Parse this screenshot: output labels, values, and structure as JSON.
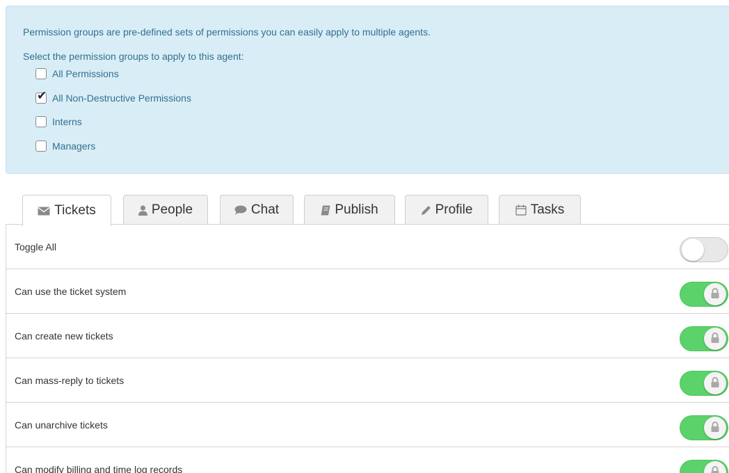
{
  "info": {
    "line1": "Permission groups are pre-defined sets of permissions you can easily apply to multiple agents.",
    "line2": "Select the permission groups to apply to this agent:",
    "groups": [
      {
        "label": "All Permissions",
        "checked": false
      },
      {
        "label": "All Non-Destructive Permissions",
        "checked": true
      },
      {
        "label": "Interns",
        "checked": false
      },
      {
        "label": "Managers",
        "checked": false
      }
    ]
  },
  "tabs": [
    {
      "label": "Tickets",
      "icon": "envelope-icon",
      "active": true
    },
    {
      "label": "People",
      "icon": "person-icon",
      "active": false
    },
    {
      "label": "Chat",
      "icon": "speech-bubble-icon",
      "active": false
    },
    {
      "label": "Publish",
      "icon": "book-icon",
      "active": false
    },
    {
      "label": "Profile",
      "icon": "pencil-icon",
      "active": false
    },
    {
      "label": "Tasks",
      "icon": "calendar-icon",
      "active": false
    }
  ],
  "permissions": [
    {
      "label": "Toggle All",
      "on": false,
      "locked": false
    },
    {
      "label": "Can use the ticket system",
      "on": true,
      "locked": true
    },
    {
      "label": "Can create new tickets",
      "on": true,
      "locked": true
    },
    {
      "label": "Can mass-reply to tickets",
      "on": true,
      "locked": true
    },
    {
      "label": "Can unarchive tickets",
      "on": true,
      "locked": true
    },
    {
      "label": "Can modify billing and time log records",
      "on": true,
      "locked": true
    }
  ],
  "colors": {
    "info_bg": "#d9edf7",
    "info_text": "#31708f",
    "toggle_on": "#5bd26a",
    "toggle_off": "#e8e8e8"
  }
}
